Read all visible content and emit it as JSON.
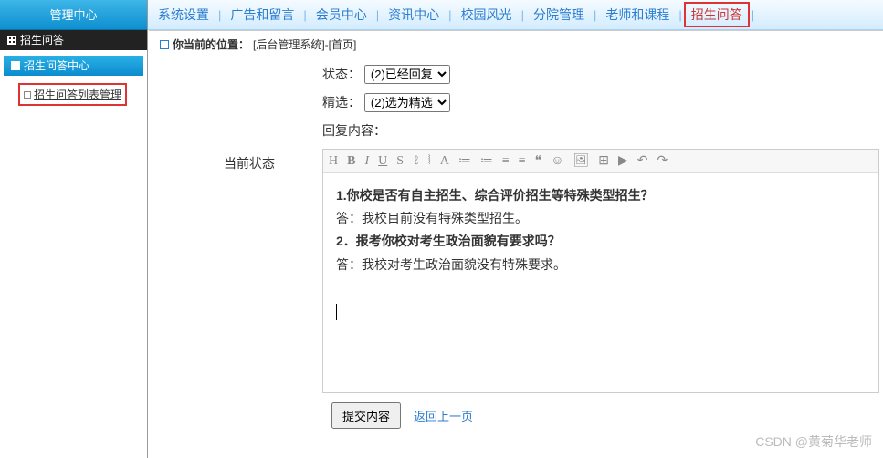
{
  "topnav": {
    "items": [
      {
        "label": "系统设置",
        "hl": false
      },
      {
        "label": "广告和留言",
        "hl": false
      },
      {
        "label": "会员中心",
        "hl": false
      },
      {
        "label": "资讯中心",
        "hl": false
      },
      {
        "label": "校园风光",
        "hl": false
      },
      {
        "label": "分院管理",
        "hl": false
      },
      {
        "label": "老师和课程",
        "hl": false
      },
      {
        "label": "招生问答",
        "hl": true
      }
    ]
  },
  "sidebar": {
    "title": "管理中心",
    "section": "招生问答",
    "center": "招生问答中心",
    "item": "招生问答列表管理"
  },
  "breadcrumb": {
    "prefix": "你当前的位置：",
    "path": "[后台管理系统]-[首页]"
  },
  "form": {
    "status_label": "状态：",
    "status_value": "(2)已经回复",
    "featured_label": "精选：",
    "featured_value": "(2)选为精选",
    "reply_label": "回复内容：",
    "current_label": "当前状态"
  },
  "toolbar": [
    "H",
    "B",
    "I",
    "U",
    "S",
    "ℓ",
    "⦚",
    "A",
    "≔",
    "≔",
    "≡",
    "≡",
    "❝",
    "☺",
    "🖼",
    "⊞",
    "▶",
    "↶",
    "↷"
  ],
  "content": {
    "q1": "1.你校是否有自主招生、综合评价招生等特殊类型招生？",
    "a1": "答：我校目前没有特殊类型招生。",
    "q2": "2．报考你校对考生政治面貌有要求吗？",
    "a2": "答：我校对考生政治面貌没有特殊要求。"
  },
  "actions": {
    "submit": "提交内容",
    "back": "返回上一页"
  },
  "watermark": "CSDN @黄菊华老师"
}
